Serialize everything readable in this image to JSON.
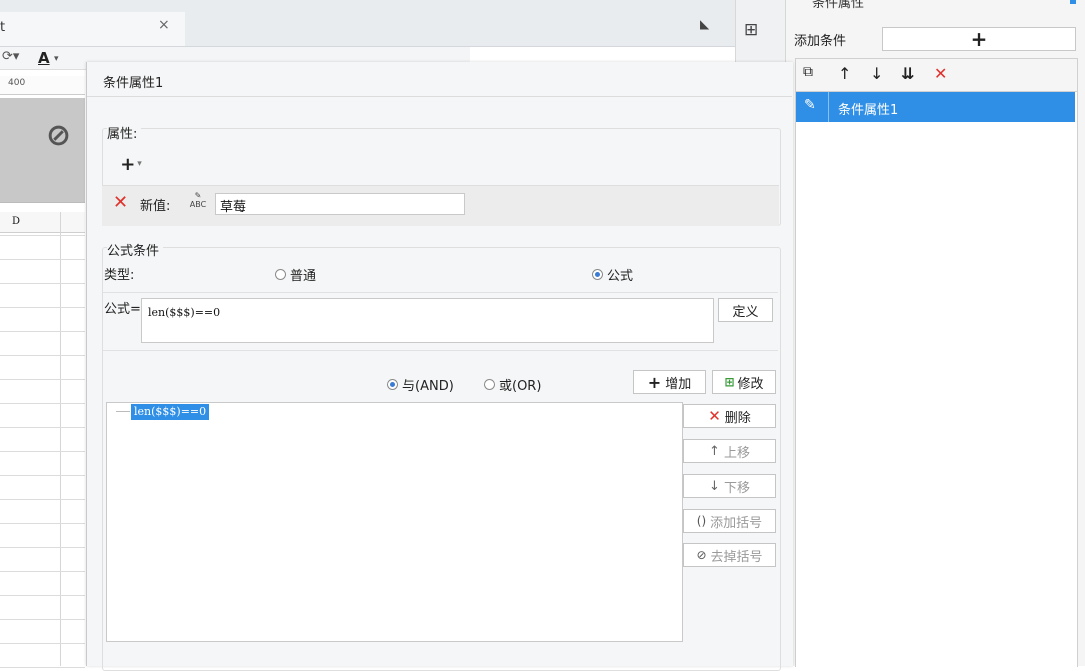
{
  "background": {
    "tab_name": "t",
    "tab_close": "×",
    "ruler_number": "400",
    "column_header": "D"
  },
  "right_panel": {
    "title": "条件属性",
    "add_condition_label": "添加条件",
    "add_button_label": "+",
    "tools": [
      "copy-icon",
      "arrow-up-icon",
      "arrow-down-icon",
      "move-bottom-icon",
      "delete-icon"
    ],
    "selected_item": "条件属性1"
  },
  "dialog": {
    "title": "条件属性1",
    "properties": {
      "label": "属性:",
      "add_button": "+",
      "new_value_label": "新值:",
      "new_value_icon_text": "ABC",
      "new_value": "草莓"
    },
    "formula_condition": {
      "label": "公式条件",
      "type_label": "类型:",
      "type_options": [
        {
          "label": "普通",
          "selected": false
        },
        {
          "label": "公式",
          "selected": true
        }
      ],
      "formula_label": "公式=",
      "formula_value": "len($$$)==0",
      "define_button": "定义",
      "logic_options": [
        {
          "label": "与(AND)",
          "selected": true
        },
        {
          "label": "或(OR)",
          "selected": false
        }
      ],
      "add_button": "增加",
      "modify_button": "修改",
      "conditions": [
        "len($$$)==0"
      ],
      "side_buttons": {
        "delete": "删除",
        "move_up": "上移",
        "move_down": "下移",
        "add_bracket": "添加括号",
        "remove_bracket": "去掉括号"
      }
    }
  },
  "colors": {
    "accent": "#2f8fe6",
    "delete_red": "#e0312b",
    "modify_green": "#3a9a3a"
  }
}
